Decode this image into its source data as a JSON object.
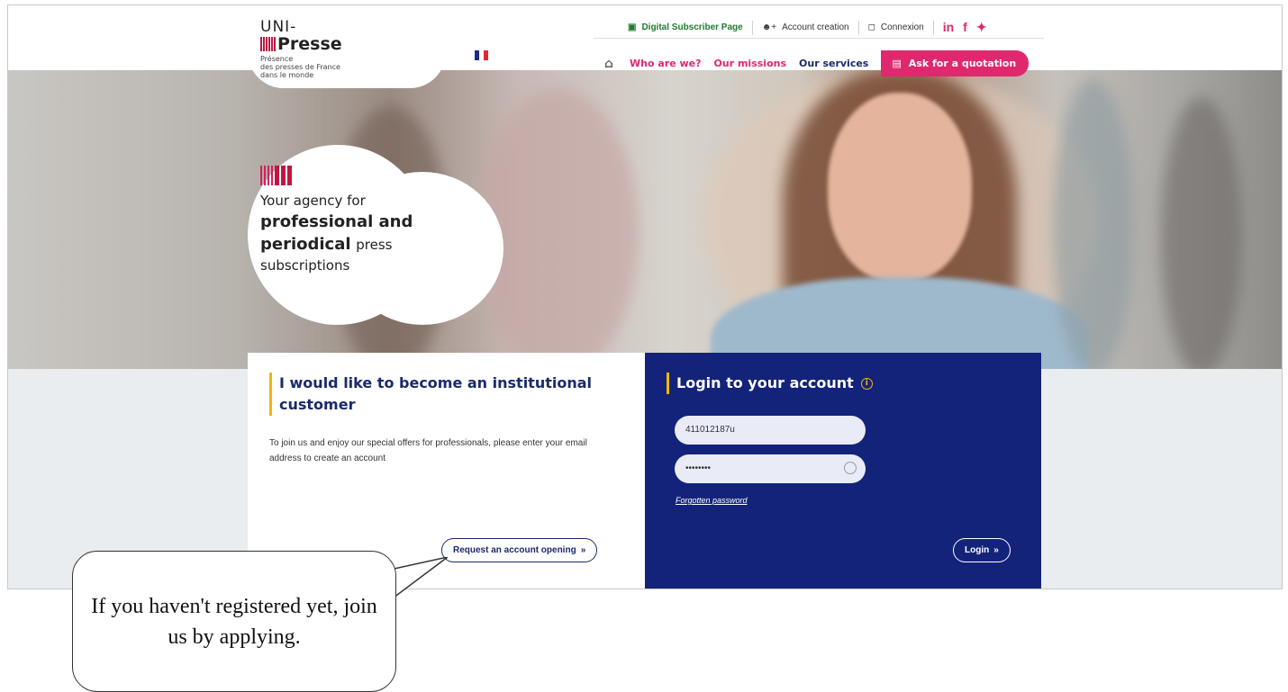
{
  "logo": {
    "uni": "UNI-",
    "presse": "Presse",
    "subtitle_lines": [
      "Présence",
      "des presses de France",
      "dans le monde"
    ]
  },
  "header": {
    "top_links": [
      {
        "label": "Digital Subscriber Page",
        "icon": "book-icon"
      },
      {
        "label": "Account creation",
        "icon": "user-add-icon"
      },
      {
        "label": "Connexion",
        "icon": "lock-icon"
      }
    ],
    "social": [
      "in",
      "f",
      "t"
    ],
    "nav": {
      "home_icon": "home-icon",
      "items": [
        "Who are we?",
        "Our missions",
        "Our services"
      ],
      "cta": "Ask for a quotation"
    },
    "colors": {
      "accent": "#e0286e",
      "navy": "#14237a",
      "yellow": "#f2b705",
      "green": "#1f7a2e"
    }
  },
  "hero": {
    "tagline_line1": "Your agency for",
    "tagline_line2": "professional and",
    "tagline_line3_bold": "periodical",
    "tagline_line3_rest": "press",
    "tagline_line4": "subscriptions"
  },
  "institutional": {
    "title": "I would like to become an institutional customer",
    "description": "To join us and enjoy our special offers for professionals, please enter your email address to create an account",
    "button": "Request an account opening"
  },
  "login": {
    "title": "Login to your account",
    "username_value": "411012187u",
    "password_value": "••••••••",
    "forgot": "Forgotten password",
    "button": "Login"
  },
  "callout": {
    "text": "If you haven't registered yet, join us by applying."
  }
}
